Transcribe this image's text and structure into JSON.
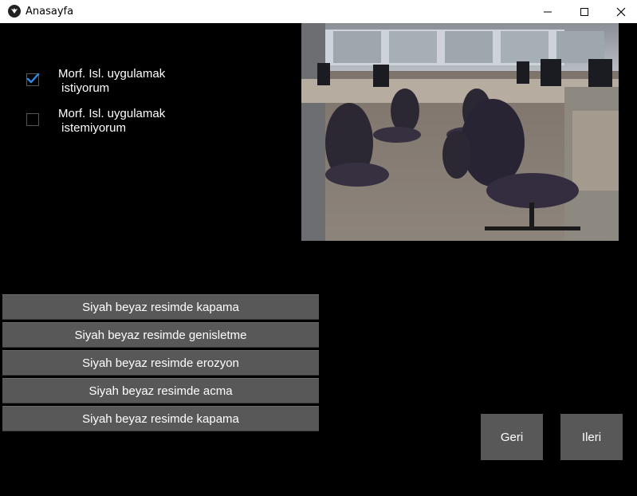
{
  "window": {
    "title": "Anasayfa"
  },
  "options": [
    {
      "label_line1": "Morf. Isl. uygulamak",
      "label_line2": " istiyorum",
      "checked": true
    },
    {
      "label_line1": "Morf. Isl. uygulamak",
      "label_line2": " istemiyorum",
      "checked": false
    }
  ],
  "operations": [
    "Siyah beyaz resimde kapama",
    "Siyah beyaz resimde genisletme",
    "Siyah beyaz resimde erozyon",
    "Siyah beyaz resimde acma",
    "Siyah beyaz resimde kapama"
  ],
  "nav": {
    "back_label": "Geri",
    "next_label": "Ileri"
  },
  "colors": {
    "check_accent": "#2f8de4",
    "button_bg": "#585858"
  }
}
